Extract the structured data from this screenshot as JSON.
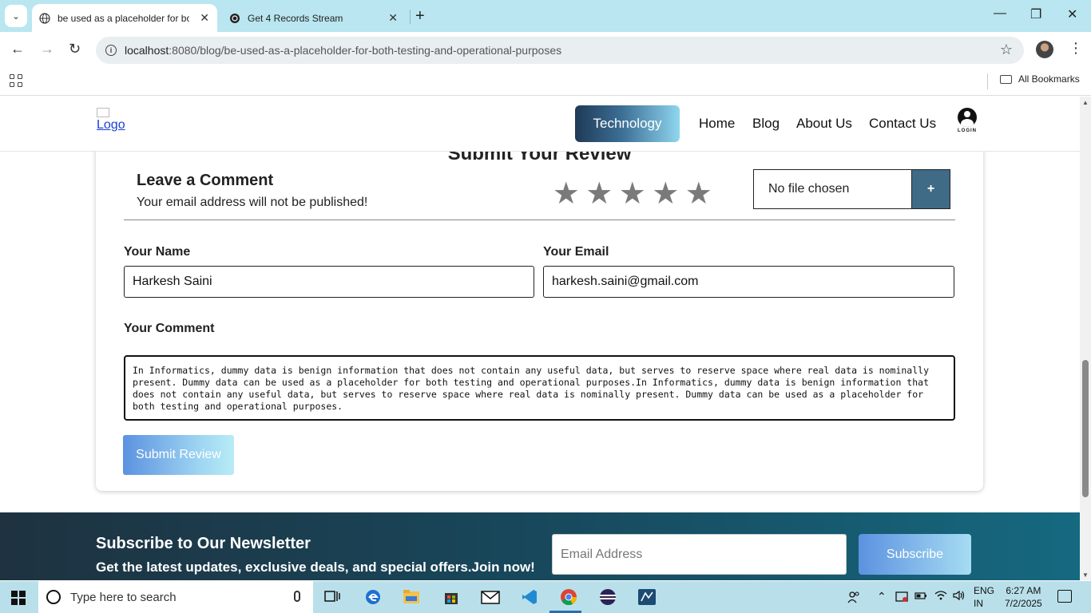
{
  "browser": {
    "tabs": [
      {
        "title": "be used as a placeholder for bo",
        "active": true
      },
      {
        "title": "Get 4 Records Stream",
        "active": false
      }
    ],
    "url_host": "localhost",
    "url_path": ":8080/blog/be-used-as-a-placeholder-for-both-testing-and-operational-purposes",
    "bookmarks_label": "All Bookmarks"
  },
  "site": {
    "logo_alt": "Logo",
    "nav": {
      "active": "Technology",
      "links": [
        "Home",
        "Blog",
        "About Us",
        "Contact Us"
      ],
      "login_label": "LOGIN"
    }
  },
  "review": {
    "heading": "Submit Your Review",
    "leave_comment_title": "Leave a Comment",
    "leave_comment_sub": "Your email address will not be published!",
    "stars": [
      "★",
      "★",
      "★",
      "★",
      "★"
    ],
    "file_label": "No file chosen",
    "file_add": "+",
    "name_label": "Your Name",
    "name_value": "Harkesh Saini",
    "email_label": "Your Email",
    "email_value": "harkesh.saini@gmail.com",
    "comment_label": "Your Comment",
    "comment_value": "In Informatics, dummy data is benign information that does not contain any useful data, but serves to reserve space where real data is nominally present. Dummy data can be used as a placeholder for both testing and operational purposes.In Informatics, dummy data is benign information that does not contain any useful data, but serves to reserve space where real data is nominally present. Dummy data can be used as a placeholder for both testing and operational purposes.",
    "submit_label": "Submit Review"
  },
  "newsletter": {
    "title": "Subscribe to Our Newsletter",
    "subtitle": "Get the latest updates, exclusive deals, and special offers.Join now!",
    "email_placeholder": "Email Address",
    "subscribe_label": "Subscribe"
  },
  "taskbar": {
    "search_placeholder": "Type here to search",
    "lang_line1": "ENG",
    "lang_line2": "IN",
    "time": "6:27 AM",
    "date": "7/2/2025"
  },
  "colors": {
    "tabstrip": "#b9e6f0",
    "nav_active_from": "#1f3a57",
    "nav_active_to": "#8fd6ef",
    "file_button": "#3f6b86",
    "newsletter_bg": "#18485c"
  }
}
